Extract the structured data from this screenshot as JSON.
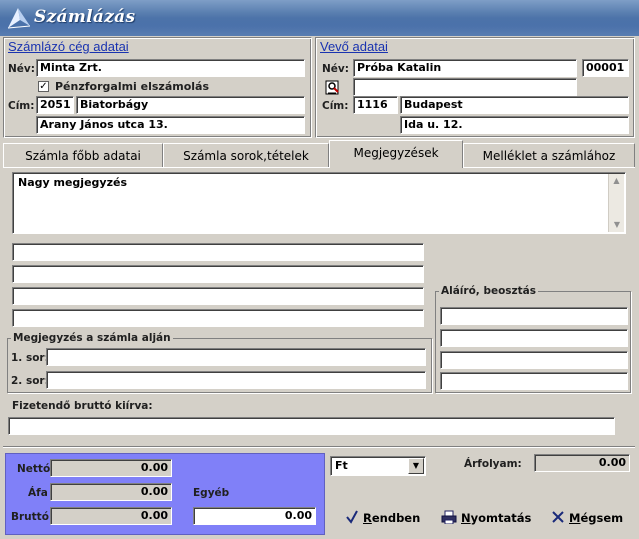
{
  "app": {
    "title": "Számlázás"
  },
  "issuer": {
    "section_title": "Számlázó cég adatai",
    "name_label": "Név:",
    "name": "Minta Zrt.",
    "cash_accounting_label": "Pénzforgalmi elszámolás",
    "cash_accounting_checked": true,
    "address_label": "Cím:",
    "zip": "2051",
    "city": "Biatorbágy",
    "street": "Arany János utca 13."
  },
  "buyer": {
    "section_title": "Vevő adatai",
    "name_label": "Név:",
    "name": "Próba Katalin",
    "code": "00001",
    "name2": "",
    "address_label": "Cím:",
    "zip": "1116",
    "city": "Budapest",
    "street": "Ida u. 12."
  },
  "tabs": [
    {
      "label": "Számla főbb adatai"
    },
    {
      "label": "Számla sorok,tételek"
    },
    {
      "label": "Megjegyzések"
    },
    {
      "label": "Melléklet a számlához"
    }
  ],
  "notes": {
    "big_note": "Nagy megjegyzés",
    "extra_lines": [
      "",
      "",
      "",
      ""
    ],
    "signer_title": "Aláíró, beosztás",
    "signer_lines": [
      "",
      "",
      "",
      ""
    ],
    "bottom_group_title": "Megjegyzés a számla alján",
    "row1_label": "1. sor:",
    "row1_value": "",
    "row2_label": "2. sor:",
    "row2_value": "",
    "gross_words_label": "Fizetendő bruttó kiírva:",
    "gross_words_value": ""
  },
  "totals": {
    "net_label": "Nettó",
    "net": "0.00",
    "vat_label": "Áfa",
    "vat": "0.00",
    "gross_label": "Bruttó",
    "gross": "0.00",
    "other_label": "Egyéb",
    "other": "0.00"
  },
  "currency": {
    "selected": "Ft",
    "rate_label": "Árfolyam:",
    "rate": "0.00"
  },
  "buttons": {
    "ok_mnemonic": "R",
    "ok_rest": "endben",
    "print_mnemonic": "N",
    "print_rest": "yomtatás",
    "cancel_mnemonic": "M",
    "cancel_rest": "égsem"
  },
  "colors": {
    "totals_bg": "#8080f8",
    "section_title": "#1a33b0"
  }
}
